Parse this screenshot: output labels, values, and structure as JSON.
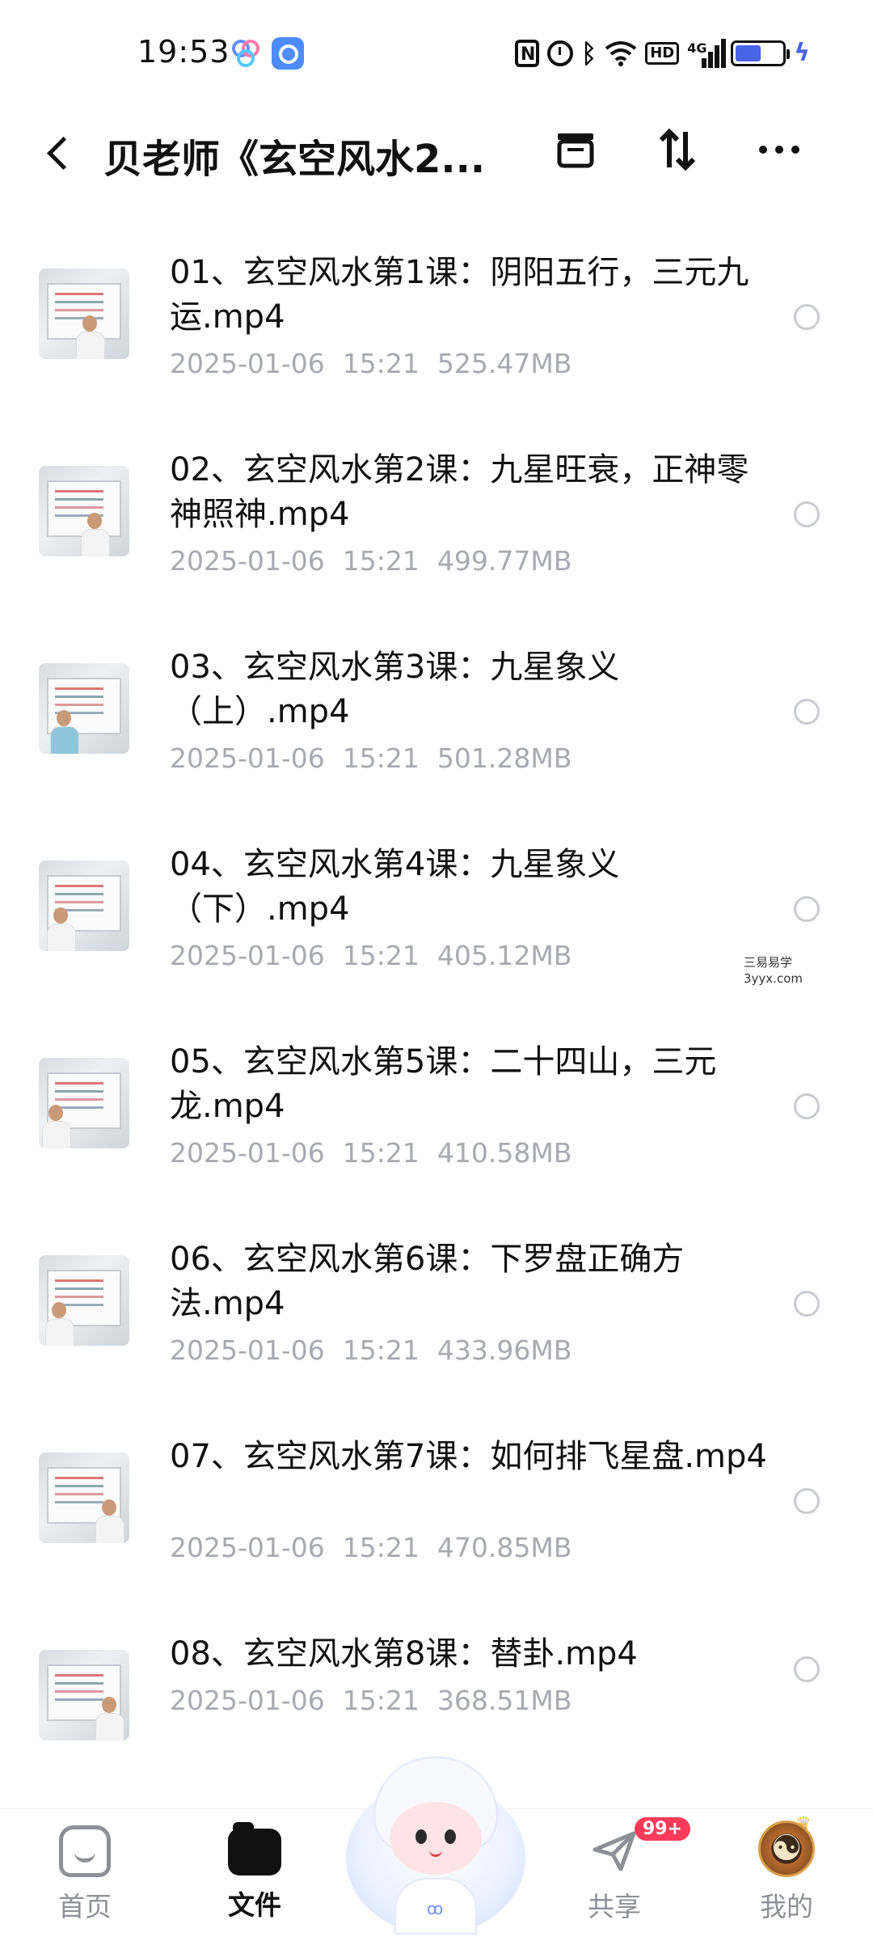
{
  "status_bar": {
    "time": "19:53",
    "network": "4G",
    "hd_label": "HD",
    "battery_level": 0.55,
    "accent_color": "#4a64e8"
  },
  "header": {
    "title": "贝老师《玄空风水2...",
    "icons": [
      "back-icon",
      "archive-icon",
      "sort-icon",
      "more-icon"
    ]
  },
  "files": [
    {
      "name": "01、玄空风水第1课：阴阳五行，三元九运.mp4",
      "date": "2025-01-06",
      "time": "15:21",
      "size": "525.47MB"
    },
    {
      "name": "02、玄空风水第2课：九星旺衰，正神零神照神.mp4",
      "date": "2025-01-06",
      "time": "15:21",
      "size": "499.77MB"
    },
    {
      "name": "03、玄空风水第3课：九星象义（上）.mp4",
      "date": "2025-01-06",
      "time": "15:21",
      "size": "501.28MB"
    },
    {
      "name": "04、玄空风水第4课：九星象义（下）.mp4",
      "date": "2025-01-06",
      "time": "15:21",
      "size": "405.12MB"
    },
    {
      "name": "05、玄空风水第5课：二十四山，三元龙.mp4",
      "date": "2025-01-06",
      "time": "15:21",
      "size": "410.58MB"
    },
    {
      "name": "06、玄空风水第6课：下罗盘正确方法.mp4",
      "date": "2025-01-06",
      "time": "15:21",
      "size": "433.96MB"
    },
    {
      "name": "07、玄空风水第7课：如何排飞星盘.mp4",
      "date": "2025-01-06",
      "time": "15:21",
      "size": "470.85MB"
    },
    {
      "name": "08、玄空风水第8课：替卦.mp4",
      "date": "2025-01-06",
      "time": "15:21",
      "size": "368.51MB"
    }
  ],
  "watermark": {
    "line1": "三易易学",
    "line2": "3yyx.com"
  },
  "bottom_nav": {
    "home": "首页",
    "files": "文件",
    "share": "共享",
    "share_badge": "99+",
    "me": "我的"
  }
}
